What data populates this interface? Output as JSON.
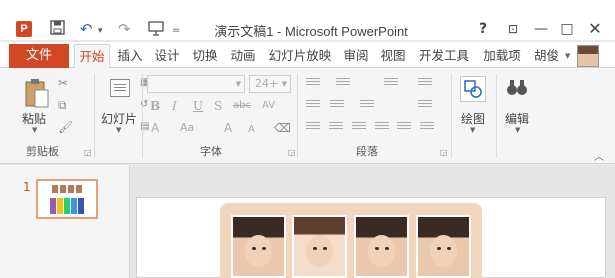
{
  "titlebar": {
    "app_logo": "P",
    "doc_title": "演示文稿1 - Microsoft PowerPoint",
    "help": "?",
    "ribbon_display": "⊡",
    "minimize": "—",
    "maximize": "□",
    "close": "✕"
  },
  "quick_access": {
    "save_icon": "💾",
    "undo_icon": "↶",
    "undo_dropdown": "▾",
    "redo_icon": "↷",
    "present_icon": "⊡",
    "customize": "="
  },
  "tabs": {
    "file": "文件",
    "items": [
      "开始",
      "插入",
      "设计",
      "切换",
      "动画",
      "幻灯片放映",
      "审阅",
      "视图",
      "开发工具",
      "加载项"
    ],
    "active": "开始",
    "user_name": "胡俊"
  },
  "ribbon": {
    "clipboard": {
      "paste_label": "粘贴",
      "group_label": "剪贴板"
    },
    "slides": {
      "new_slide_label": "幻灯片"
    },
    "font": {
      "font_name": "",
      "font_size": "24+",
      "bold": "B",
      "italic": "I",
      "underline": "U",
      "strike": "S",
      "abc": "abc",
      "spacing": "AV",
      "font_color": "A",
      "case": "Aa",
      "grow": "A",
      "shrink": "A",
      "group_label": "字体"
    },
    "paragraph": {
      "group_label": "段落"
    },
    "drawing": {
      "label": "绘图"
    },
    "editing": {
      "label": "编辑"
    }
  },
  "slides_pane": {
    "slide_number": "1"
  },
  "colors": {
    "accent": "#d24726",
    "ribbon_bg": "#f5f5f5",
    "photo_frame": "#f2d6bd",
    "thumb_border": "#e8a07a"
  }
}
